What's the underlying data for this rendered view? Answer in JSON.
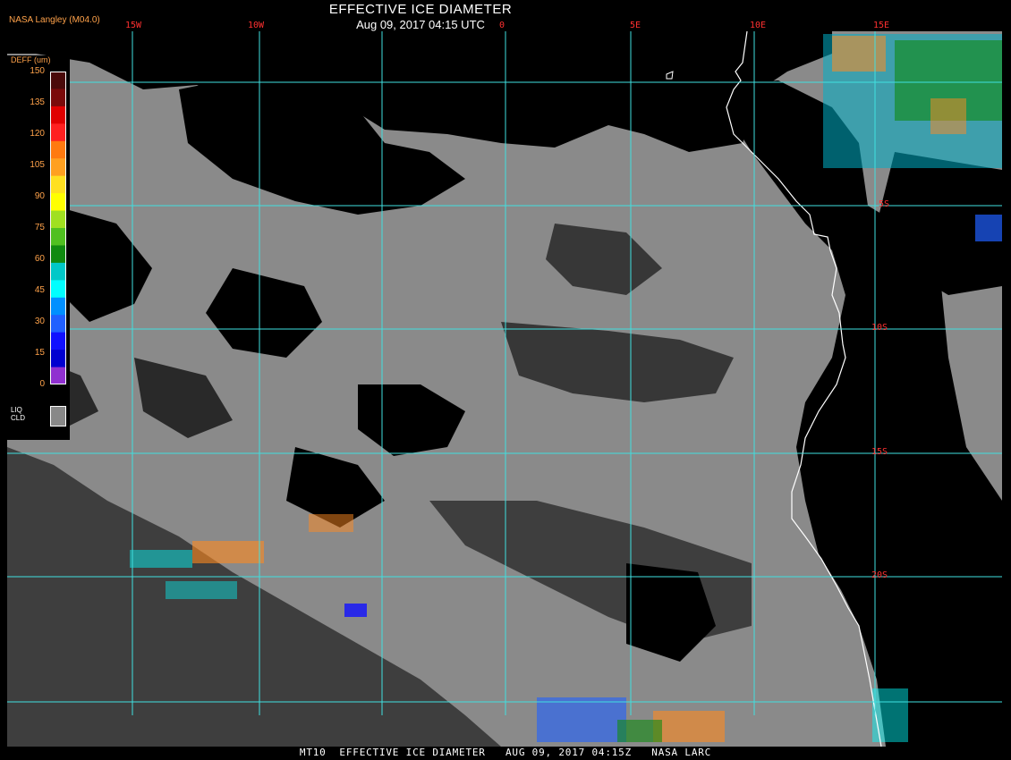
{
  "header": {
    "title": "EFFECTIVE ICE DIAMETER",
    "datetime": "Aug 09, 2017 04:15 UTC",
    "credit": "NASA Langley (M04.0)"
  },
  "footer": {
    "text": "MT10  EFFECTIVE ICE DIAMETER   AUG 09, 2017 04:15Z   NASA LARC"
  },
  "legend": {
    "title": "DEFF (um)",
    "ticks": [
      "150",
      "135",
      "120",
      "105",
      "90",
      "75",
      "60",
      "45",
      "30",
      "15",
      "0"
    ],
    "colors": [
      "#4a0a0a",
      "#7a0a0a",
      "#e00000",
      "#ff2020",
      "#ff7a10",
      "#ffa020",
      "#ffe020",
      "#ffff00",
      "#a0e020",
      "#50c020",
      "#108a10",
      "#00c8c8",
      "#00ffff",
      "#0090ff",
      "#2060ff",
      "#1010ff",
      "#0000d0",
      "#9030d0"
    ],
    "liquid_label_1": "LIQ",
    "liquid_label_2": "CLD",
    "liquid_color": "#888888"
  },
  "grid": {
    "lon_labels": [
      "15W",
      "10W",
      "0",
      "5E",
      "10E",
      "15E"
    ],
    "lat_labels": [
      "5S",
      "10S",
      "15S",
      "20S"
    ]
  },
  "colors": {
    "cloud": "#8a8a8a",
    "clear": "#000000",
    "grid": "#40e0e0",
    "coast": "#ffffff"
  }
}
